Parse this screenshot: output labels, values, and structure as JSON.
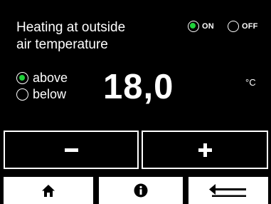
{
  "colors": {
    "background": "#000000",
    "foreground": "#ffffff",
    "accent": "#1fd13a"
  },
  "header": {
    "title_line1": "Heating at outside",
    "title_line2": "air temperature"
  },
  "power": {
    "on_label": "ON",
    "off_label": "OFF",
    "selected": "ON"
  },
  "mode": {
    "above_label": "above",
    "below_label": "below",
    "selected": "above"
  },
  "setpoint": {
    "value": "18,0",
    "unit": "°C"
  },
  "controls": {
    "decrease_icon": "minus-icon",
    "increase_icon": "plus-icon"
  },
  "nav": {
    "home_icon": "home-icon",
    "info_icon": "info-icon",
    "back_icon": "back-arrow-icon"
  }
}
